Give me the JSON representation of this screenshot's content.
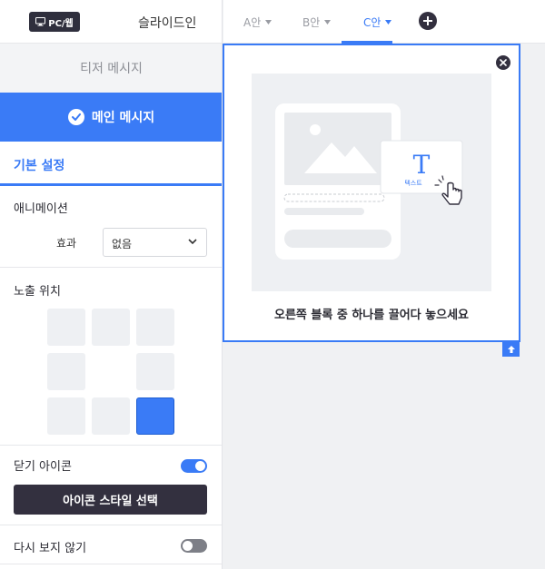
{
  "header": {
    "device_badge": "PC/웹",
    "slide_title": "슬라이드인"
  },
  "tabs": [
    {
      "label": "A안",
      "active": false
    },
    {
      "label": "B안",
      "active": false
    },
    {
      "label": "C안",
      "active": true
    }
  ],
  "sidebar": {
    "teaser_message": "티저 메시지",
    "main_message": "메인 메시지",
    "basic_settings": "기본 설정",
    "animation": {
      "label": "애니메이션",
      "effect_label": "효과",
      "effect_value": "없음"
    },
    "position": {
      "label": "노출 위치",
      "selected_cell": "bottom-right"
    },
    "close_icon": {
      "label": "닫기 아이콘",
      "enabled": true,
      "style_button": "아이콘 스타일 선택"
    },
    "dont_show_again": {
      "label": "다시 보지 않기",
      "enabled": false
    }
  },
  "preview": {
    "text_block_label": "텍스트",
    "hint": "오른쪽 블록 중 하나를 끌어다 놓으세요"
  },
  "colors": {
    "accent": "#3a7bf6",
    "dark": "#33303f"
  }
}
